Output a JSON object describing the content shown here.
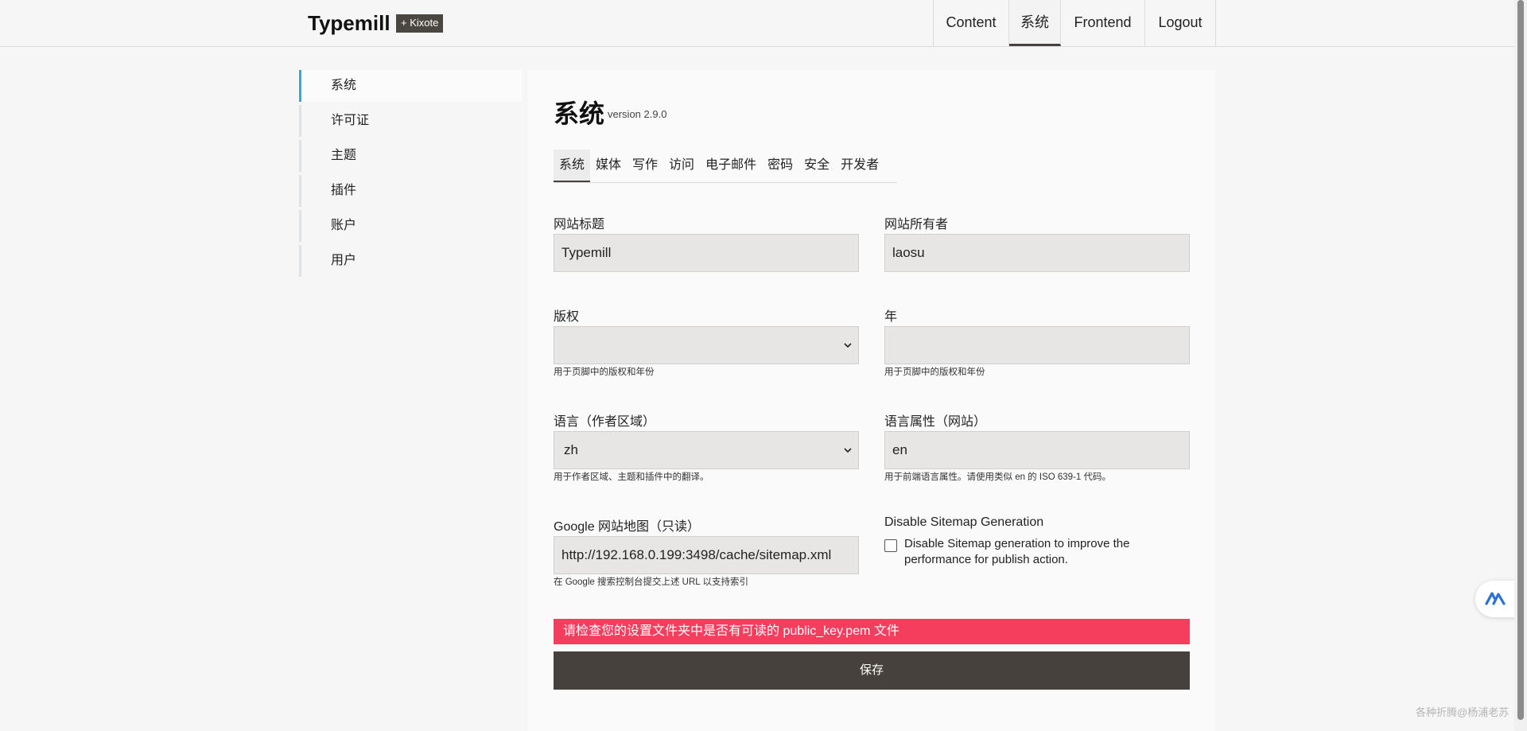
{
  "header": {
    "logo": "Typemill",
    "badge": "+ Kixote",
    "nav": [
      "Content",
      "系统",
      "Frontend",
      "Logout"
    ]
  },
  "sidebar": {
    "items": [
      "系统",
      "许可证",
      "主题",
      "插件",
      "账户",
      "用户"
    ]
  },
  "main": {
    "title": "系统",
    "version": "version 2.9.0",
    "tabs": [
      "系统",
      "媒体",
      "写作",
      "访问",
      "电子邮件",
      "密码",
      "安全",
      "开发者"
    ],
    "fields": {
      "site_title": {
        "label": "网站标题",
        "value": "Typemill"
      },
      "site_owner": {
        "label": "网站所有者",
        "value": "laosu"
      },
      "copyright": {
        "label": "版权",
        "value": "",
        "help": "用于页脚中的版权和年份"
      },
      "year": {
        "label": "年",
        "value": "",
        "help": "用于页脚中的版权和年份"
      },
      "language": {
        "label": "语言（作者区域）",
        "value": "zh",
        "help": "用于作者区域、主题和插件中的翻译。"
      },
      "lang_attr": {
        "label": "语言属性（网站）",
        "value": "en",
        "help": "用于前端语言属性。请使用类似 en 的 ISO 639-1 代码。"
      },
      "sitemap": {
        "label": "Google 网站地图（只读）",
        "value": "http://192.168.0.199:3498/cache/sitemap.xml",
        "help": "在 Google 搜索控制台提交上述 URL 以支持索引"
      },
      "disable_sitemap": {
        "label": "Disable Sitemap Generation",
        "checkbox_text": "Disable Sitemap generation to improve the performance for publish action.",
        "checked": false
      }
    },
    "alert": "请检查您的设置文件夹中是否有可读的 public_key.pem 文件",
    "save_label": "保存"
  },
  "watermark": "各种折腾@杨浦老苏",
  "colors": {
    "accent": "#39a9c8",
    "alert": "#f53d5e",
    "button": "#46413c"
  }
}
